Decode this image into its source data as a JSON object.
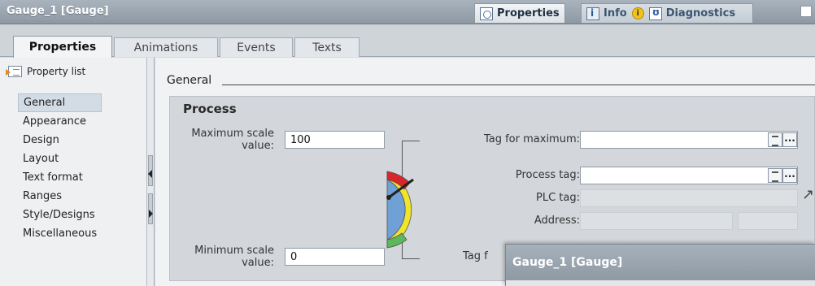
{
  "window": {
    "title": "Gauge_1 [Gauge]",
    "tabs": {
      "properties": "Properties",
      "info": "Info",
      "info_badge": "i",
      "diagnostics": "Diagnostics"
    }
  },
  "subtabs": [
    "Properties",
    "Animations",
    "Events",
    "Texts"
  ],
  "sidebar": {
    "header": "Property list",
    "items": [
      "General",
      "Appearance",
      "Design",
      "Layout",
      "Text format",
      "Ranges",
      "Style/Designs",
      "Miscellaneous"
    ],
    "selected": "General"
  },
  "main": {
    "section": "General",
    "group": "Process",
    "max_scale_label": "Maximum scale value:",
    "max_scale_value": "100",
    "min_scale_label": "Minimum scale value:",
    "min_scale_value": "0",
    "tag_max_label": "Tag for maximum:",
    "tag_max_value": "",
    "process_tag_label": "Process tag:",
    "process_tag_value": "",
    "plc_tag_label": "PLC tag:",
    "address_label": "Address:",
    "tag_min_label_partial": "Tag f",
    "ellipsis": "..."
  },
  "overlay": {
    "title": "Gauge_1 [Gauge]"
  },
  "colors": {
    "titlebar": "#96a1ac",
    "panel": "#d3d7db",
    "gauge_red": "#d8262a",
    "gauge_yellow": "#f0e52a",
    "gauge_green": "#5cb85c",
    "gauge_face": "#6fa0d6"
  }
}
